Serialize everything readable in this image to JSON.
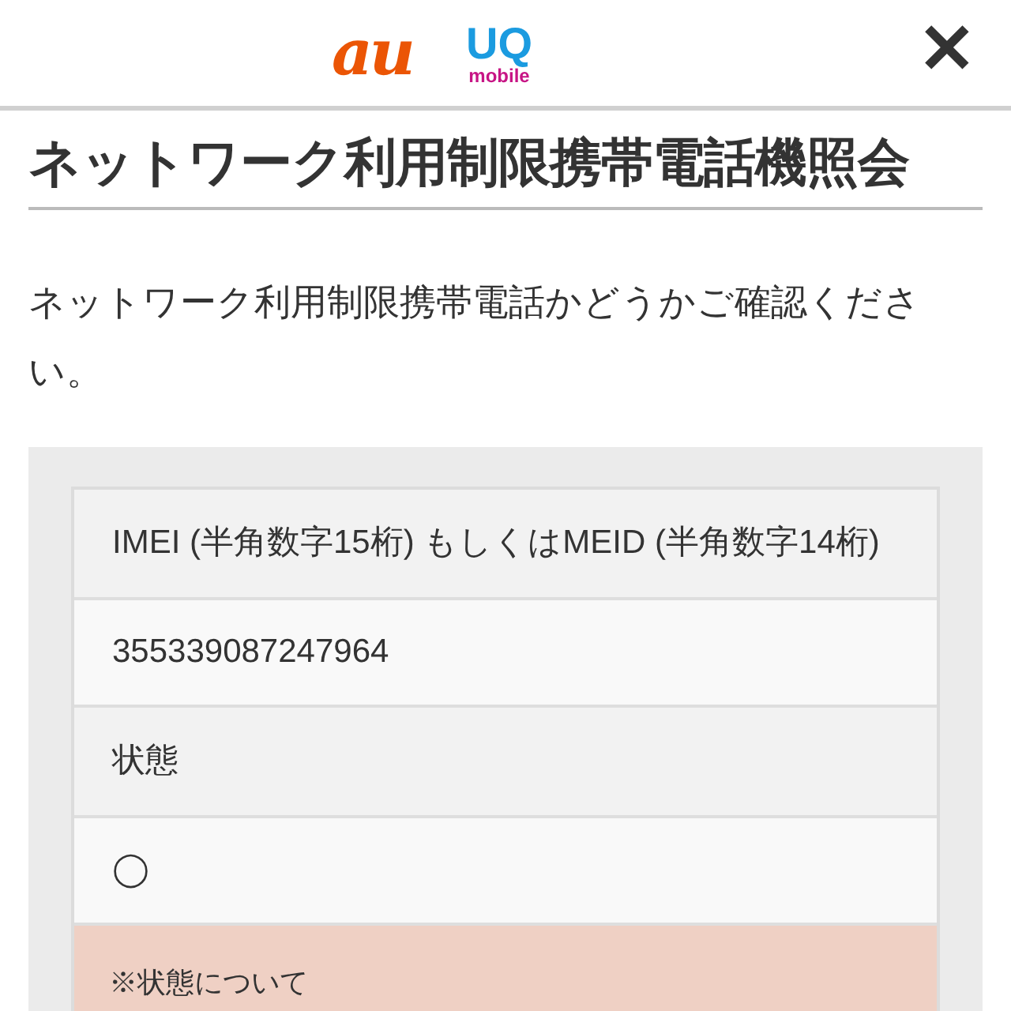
{
  "header": {
    "logos": [
      "au",
      "UQ",
      "mobile"
    ],
    "close": "✕"
  },
  "title": "ネットワーク利用制限携帯電話機照会",
  "description": "ネットワーク利用制限携帯電話かどうかご確認ください。",
  "result_table": {
    "rows": [
      {
        "kind": "label",
        "text": "IMEI (半角数字15桁) もしくはMEID (半角数字14桁)"
      },
      {
        "kind": "value",
        "text": "355339087247964"
      },
      {
        "kind": "label",
        "text": "状態"
      },
      {
        "kind": "value",
        "text": "◯"
      },
      {
        "kind": "note",
        "text": "※状態について"
      }
    ]
  }
}
